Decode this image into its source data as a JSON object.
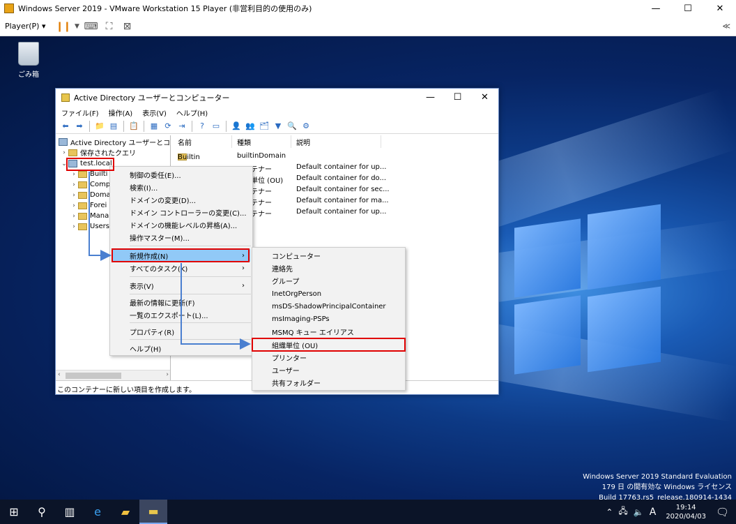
{
  "vm": {
    "title": "Windows Server 2019 - VMware Workstation 15 Player (非営利目的の使用のみ)",
    "player_menu": "Player(P) ▾",
    "minimize": "—",
    "maximize": "☐",
    "close": "✕",
    "right_glyph": "≪"
  },
  "desktop": {
    "recycle_label": "ごみ箱",
    "watermark": [
      "Windows Server 2019 Standard Evaluation",
      "179 日 の間有効な Windows ライセンス",
      "Build 17763.rs5_release.180914-1434"
    ]
  },
  "taskbar": {
    "time": "19:14",
    "date": "2020/04/03",
    "ime": "A"
  },
  "ad": {
    "title": "Active Directory ユーザーとコンピューター",
    "menu": [
      "ファイル(F)",
      "操作(A)",
      "表示(V)",
      "ヘルプ(H)"
    ],
    "tree": {
      "root": "Active Directory ユーザーとコンピュー",
      "saved": "保存されたクエリ",
      "domain": "test.local",
      "children": [
        "Builti",
        "Comp",
        "Doma",
        "Forei",
        "Mana",
        "Users"
      ]
    },
    "columns": [
      "名前",
      "種類",
      "説明"
    ],
    "rows": [
      {
        "name": "Builtin",
        "type": "builtinDomain",
        "desc": ""
      },
      {
        "name": "",
        "type": "コンテナー",
        "desc": "Default container for up..."
      },
      {
        "name": "",
        "type": "組織単位 (OU)",
        "desc": "Default container for do..."
      },
      {
        "name": "",
        "type": "コンテナー",
        "desc": "Default container for sec..."
      },
      {
        "name": "",
        "type": "コンテナー",
        "desc": "Default container for ma..."
      },
      {
        "name": "",
        "type": "コンテナー",
        "desc": "Default container for up..."
      }
    ],
    "status": "このコンテナーに新しい項目を作成します。"
  },
  "menu1": {
    "items": [
      "制御の委任(E)...",
      "検索(I)...",
      "ドメインの変更(D)...",
      "ドメイン コントローラーの変更(C)...",
      "ドメインの機能レベルの昇格(A)...",
      "操作マスター(M)...",
      "新規作成(N)",
      "すべてのタスク(K)",
      "表示(V)",
      "最新の情報に更新(F)",
      "一覧のエクスポート(L)...",
      "プロパティ(R)",
      "ヘルプ(H)"
    ]
  },
  "menu2": {
    "items": [
      "コンピューター",
      "連絡先",
      "グループ",
      "InetOrgPerson",
      "msDS-ShadowPrincipalContainer",
      "msImaging-PSPs",
      "MSMQ キュー エイリアス",
      "組織単位 (OU)",
      "プリンター",
      "ユーザー",
      "共有フォルダー"
    ]
  },
  "colors": {
    "highlight": "#91c9f7",
    "annotation_red": "#e00000",
    "arrow_blue": "#4a7fd0"
  }
}
